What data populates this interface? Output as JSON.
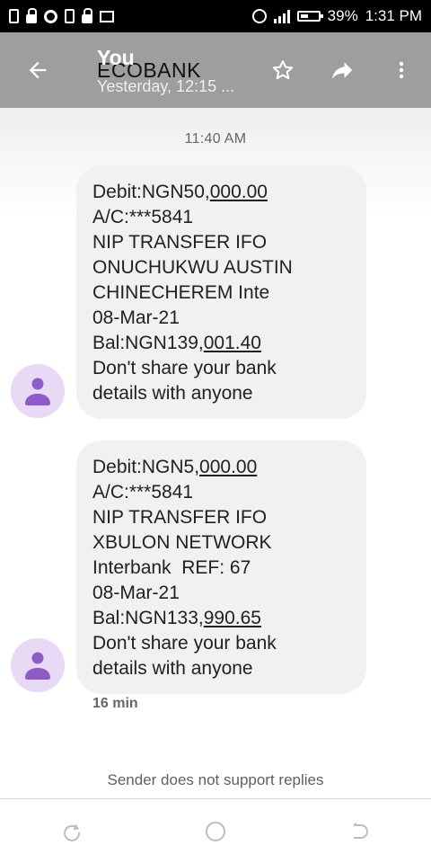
{
  "status_bar": {
    "battery": "39%",
    "time": "1:31 PM",
    "icons": [
      "phone-icon",
      "lock-icon",
      "chrome-icon",
      "sim-icon",
      "lock-icon",
      "image-icon",
      "alarm-icon",
      "signal-icon",
      "battery-icon"
    ]
  },
  "app_bar": {
    "title_overlay": "You",
    "title": "ECOBANK",
    "subtitle": "Yesterday, 12:15 ...",
    "icons": [
      "back-arrow-icon",
      "star-icon",
      "forward-icon",
      "more-vert-icon"
    ]
  },
  "conversation": {
    "timestamp": "11:40 AM",
    "messages": [
      {
        "lines": [
          {
            "pre": "Debit:NGN50,",
            "u": "000.00",
            "post": ""
          },
          {
            "pre": "A/C:***5841",
            "u": "",
            "post": ""
          },
          {
            "pre": "NIP TRANSFER IFO",
            "u": "",
            "post": ""
          },
          {
            "pre": "ONUCHUKWU AUSTIN",
            "u": "",
            "post": ""
          },
          {
            "pre": "CHINECHEREM Inte",
            "u": "",
            "post": ""
          },
          {
            "pre": "08-Mar-21",
            "u": "",
            "post": ""
          },
          {
            "pre": "Bal:NGN139,",
            "u": "001.40",
            "post": ""
          },
          {
            "pre": "Don't share your bank",
            "u": "",
            "post": ""
          },
          {
            "pre": "details with anyone",
            "u": "",
            "post": ""
          }
        ]
      },
      {
        "lines": [
          {
            "pre": "Debit:NGN5,",
            "u": "000.00",
            "post": ""
          },
          {
            "pre": "A/C:***5841",
            "u": "",
            "post": ""
          },
          {
            "pre": "NIP TRANSFER IFO",
            "u": "",
            "post": ""
          },
          {
            "pre": "XBULON NETWORK",
            "u": "",
            "post": ""
          },
          {
            "pre": "Interbank  REF: 67",
            "u": "",
            "post": ""
          },
          {
            "pre": "08-Mar-21",
            "u": "",
            "post": ""
          },
          {
            "pre": "Bal:NGN133,",
            "u": "990.65",
            "post": ""
          },
          {
            "pre": "Don't share your bank",
            "u": "",
            "post": ""
          },
          {
            "pre": "details with anyone",
            "u": "",
            "post": ""
          }
        ]
      }
    ],
    "last_meta": "16 min",
    "footer_note": "Sender does not support replies"
  },
  "nav_bar": {
    "icons": [
      "recents-icon",
      "home-icon",
      "back-icon"
    ]
  },
  "colors": {
    "app_bar": "#9e9e9e",
    "bubble": "#f1f1f1",
    "avatar_bg": "#e8d9f5",
    "avatar_fg": "#8e5cc8"
  }
}
